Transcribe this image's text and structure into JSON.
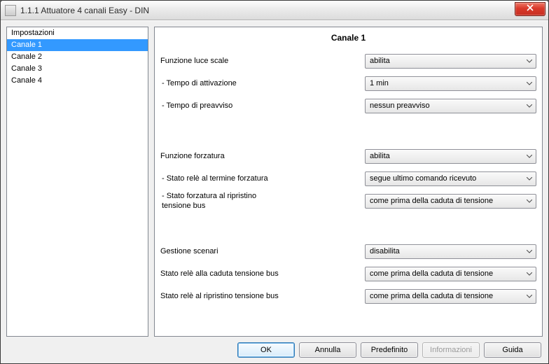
{
  "window": {
    "title": "1.1.1 Attuatore 4 canali Easy - DIN"
  },
  "sidebar": {
    "items": [
      {
        "label": "Impostazioni"
      },
      {
        "label": "Canale 1"
      },
      {
        "label": "Canale 2"
      },
      {
        "label": "Canale 3"
      },
      {
        "label": "Canale 4"
      }
    ],
    "selected_index": 1
  },
  "panel": {
    "title": "Canale 1",
    "rows": [
      {
        "label": "Funzione luce scale",
        "value": "abilita"
      },
      {
        "label": "- Tempo di attivazione",
        "value": "1 min"
      },
      {
        "label": "- Tempo di preavviso",
        "value": "nessun preavviso"
      },
      {
        "label": "Funzione forzatura",
        "value": "abilita"
      },
      {
        "label": "- Stato relè al termine forzatura",
        "value": "segue ultimo comando ricevuto"
      },
      {
        "label": "- Stato forzatura al ripristino\n  tensione bus",
        "value": "come prima della caduta di tensione"
      },
      {
        "label": "Gestione scenari",
        "value": "disabilita"
      },
      {
        "label": "Stato relè alla caduta tensione bus",
        "value": "come prima della caduta di tensione"
      },
      {
        "label": "Stato relè al ripristino tensione bus",
        "value": "come prima della caduta di tensione"
      }
    ]
  },
  "buttons": {
    "ok": "OK",
    "cancel": "Annulla",
    "default": "Predefinito",
    "info": "Informazioni",
    "help": "Guida"
  }
}
